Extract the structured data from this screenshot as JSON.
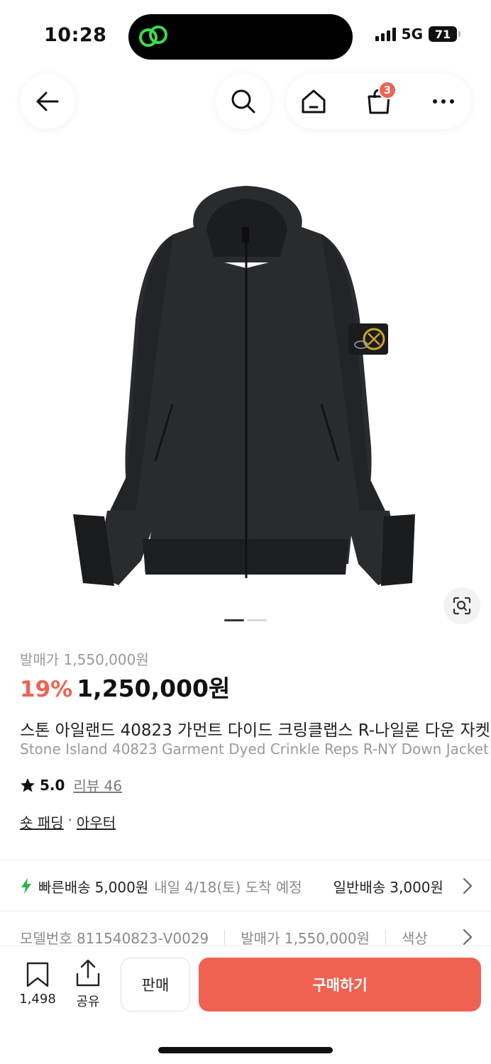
{
  "status_bar": {
    "time": "10:28",
    "network": "5G",
    "battery": "71",
    "island_icon": "link-rings-icon"
  },
  "nav": {
    "back_icon": "arrow-left-icon",
    "search_icon": "search-icon",
    "home_icon": "home-icon",
    "cart_icon": "shopping-bag-icon",
    "cart_count": "3",
    "more_icon": "more-horizontal-icon"
  },
  "product": {
    "image": "black-hooded-down-jacket",
    "image_count": 2,
    "active_image": 1,
    "lens_icon": "image-search-icon",
    "original_price": "발매가 1,550,000원",
    "discount": "19%",
    "sale_price": "1,250,000원",
    "title_ko": "스톤 아일랜드 40823 가먼트 다이드 크링클랩스 R-나일론 다운 자켓",
    "title_en": "Stone Island 40823 Garment Dyed Crinkle Reps R-NY Down Jacket",
    "rating": "5.0",
    "review_label": "리뷰 46",
    "categories": [
      "숏 패딩",
      "아우터"
    ],
    "category_separator": "·"
  },
  "delivery": {
    "fast_label": "빠른배송",
    "fast_price": "5,000원",
    "arrival": "내일 4/18(토) 도착 예정",
    "normal_label": "일반배송",
    "normal_price": "3,000원"
  },
  "info": {
    "model": "모델번호 811540823-V0029",
    "release_price": "발매가 1,550,000원",
    "color": "색상"
  },
  "bottom_bar": {
    "bookmark_count": "1,498",
    "share_label": "공유",
    "sell_label": "판매",
    "buy_label": "구매하기"
  },
  "colors": {
    "accent": "#ef6253",
    "fast_delivery": "#2fb34a",
    "muted": "#9a9a9a"
  }
}
